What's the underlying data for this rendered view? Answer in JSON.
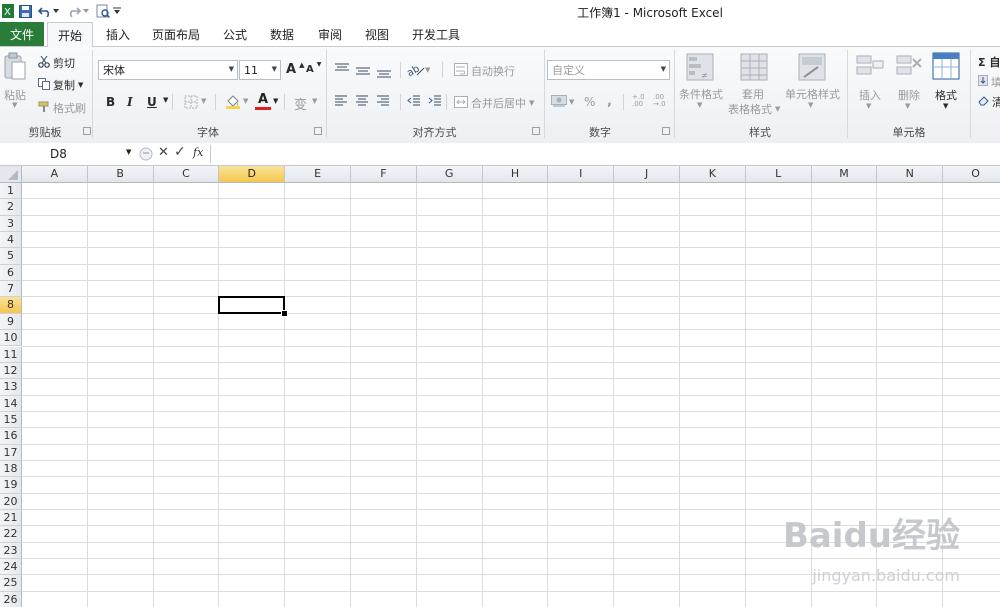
{
  "window": {
    "title": "工作簿1 - Microsoft Excel"
  },
  "tabs": [
    "文件",
    "开始",
    "插入",
    "页面布局",
    "公式",
    "数据",
    "审阅",
    "视图",
    "开发工具"
  ],
  "clipboard": {
    "paste": "粘贴",
    "cut": "剪切",
    "copy": "复制",
    "format_painter": "格式刷",
    "group_label": "剪贴板"
  },
  "font": {
    "name": "宋体",
    "size": "11",
    "grow": "A",
    "shrink": "A",
    "bold": "B",
    "italic": "I",
    "underline": "U",
    "font_color_letter": "A",
    "phonetic": "变",
    "group_label": "字体"
  },
  "alignment": {
    "wrap_text": "自动换行",
    "merge_center": "合并后居中",
    "group_label": "对齐方式"
  },
  "number": {
    "format": "自定义",
    "percent": "%",
    "comma": ",",
    "increase_decimal": "+.0 .00",
    "decrease_decimal": ".00 →.0",
    "group_label": "数字"
  },
  "styles": {
    "conditional": "条件格式",
    "table_line1": "套用",
    "table_line2": "表格格式",
    "cell_styles": "单元格样式",
    "group_label": "样式"
  },
  "cells": {
    "insert": "插入",
    "delete": "删除",
    "format": "格式",
    "group_label": "单元格"
  },
  "editing": {
    "autosum": "Σ 自",
    "fill": "填",
    "clear": "清"
  },
  "formula_bar": {
    "name_box": "D8",
    "cancel": "✕",
    "enter": "✓",
    "fx": "fx",
    "content": ""
  },
  "sheet": {
    "columns": [
      "A",
      "B",
      "C",
      "D",
      "E",
      "F",
      "G",
      "H",
      "I",
      "J",
      "K",
      "L",
      "M",
      "N",
      "O"
    ],
    "rows": [
      "1",
      "2",
      "3",
      "4",
      "5",
      "6",
      "7",
      "8",
      "9",
      "10",
      "11",
      "12",
      "13",
      "14",
      "15",
      "16",
      "17",
      "18",
      "19",
      "20",
      "21",
      "22",
      "23",
      "24",
      "25",
      "26"
    ],
    "selected_column": "D",
    "selected_row": "8",
    "active_cell": "D8"
  },
  "watermark": {
    "brand": "Baidu经验",
    "url": "jingyan.baidu.com"
  },
  "colors": {
    "file_tab": "#2a7c3a",
    "selection_header": "#f4c74d",
    "grid_line": "#dadcdd"
  }
}
